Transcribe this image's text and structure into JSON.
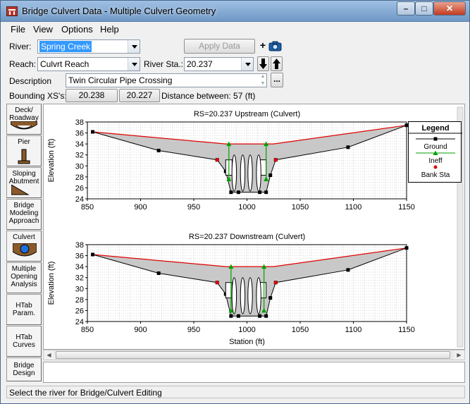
{
  "window": {
    "title": "Bridge Culvert Data - Multiple Culvert Geometry"
  },
  "menu": {
    "items": [
      "File",
      "View",
      "Options",
      "Help"
    ]
  },
  "river": {
    "label": "River:",
    "value": "Spring Creek"
  },
  "apply": {
    "label": "Apply Data"
  },
  "reach": {
    "label": "Reach:",
    "value": "Culvrt Reach"
  },
  "river_sta": {
    "label": "River Sta.:",
    "value": "20.237"
  },
  "description": {
    "label": "Description",
    "value": "Twin Circular Pipe Crossing",
    "ellipsis": "..."
  },
  "bounding": {
    "label": "Bounding XS's:",
    "upstream": "20.238",
    "downstream": "20.227",
    "distance_label": "Distance between: 57 (ft)"
  },
  "sidebar": {
    "items": [
      {
        "label": "Deck/ Roadway",
        "icon": "deck-roadway-icon"
      },
      {
        "label": "Pier",
        "icon": "pier-icon"
      },
      {
        "label": "Sloping Abutment",
        "icon": "sloping-abutment-icon"
      },
      {
        "label": "Bridge Modeling Approach"
      },
      {
        "label": "Culvert",
        "icon": "culvert-icon"
      },
      {
        "label": "Multiple Opening Analysis"
      },
      {
        "label": "HTab Param."
      },
      {
        "label": "HTab Curves"
      },
      {
        "label": "Bridge Design"
      }
    ]
  },
  "status": {
    "text": "Select the river for Bridge/Culvert Editing"
  },
  "colors": {
    "ground": "#000000",
    "ineff": "#00a000",
    "bank": "#e00000",
    "road": "#e00000",
    "fill": "#c8c8c8"
  },
  "chart_data": [
    {
      "type": "line",
      "title": "RS=20.237  Upstream  (Culvert)",
      "ylabel": "Elevation (ft)",
      "xlabel": "",
      "xlim": [
        850,
        1150
      ],
      "ylim": [
        24,
        38
      ],
      "xticks": [
        850,
        900,
        950,
        1000,
        1050,
        1100,
        1150
      ],
      "yticks": [
        24,
        26,
        28,
        30,
        32,
        34,
        36,
        38
      ],
      "grid": true,
      "legend": {
        "title": "Legend",
        "position": "top-right",
        "entries": [
          "Ground",
          "Ineff",
          "Bank Sta"
        ]
      },
      "ground": [
        [
          855,
          36.2
        ],
        [
          917,
          32.8
        ],
        [
          972,
          31.1
        ],
        [
          980,
          29.0
        ],
        [
          985,
          25.2
        ],
        [
          992,
          25.2
        ],
        [
          1012,
          25.2
        ],
        [
          1018,
          25.2
        ],
        [
          1022,
          28.3
        ],
        [
          1027,
          31.1
        ],
        [
          1095,
          33.4
        ],
        [
          1150,
          37.4
        ]
      ],
      "road_top": [
        [
          855,
          36.2
        ],
        [
          980,
          34.0
        ],
        [
          1025,
          34.0
        ],
        [
          1150,
          37.4
        ]
      ],
      "ineff": [
        [
          983,
          27.6,
          34.0
        ],
        [
          1018,
          27.6,
          34.0
        ]
      ],
      "bank": [
        [
          972,
          31.1
        ],
        [
          1027,
          31.1
        ]
      ],
      "culverts": [
        [
          988,
          30.5
        ],
        [
          996,
          30.5
        ],
        [
          1003,
          30.5
        ],
        [
          1011,
          30.5
        ]
      ],
      "culvert_boxes": [
        [
          980,
          28.3,
          986,
          31.1
        ],
        [
          1012,
          28.3,
          1018,
          31.1
        ]
      ]
    },
    {
      "type": "line",
      "title": "RS=20.237  Downstream  (Culvert)",
      "ylabel": "Elevation (ft)",
      "xlabel": "Station (ft)",
      "xlim": [
        850,
        1150
      ],
      "ylim": [
        24,
        38
      ],
      "xticks": [
        850,
        900,
        950,
        1000,
        1050,
        1100,
        1150
      ],
      "yticks": [
        24,
        26,
        28,
        30,
        32,
        34,
        36,
        38
      ],
      "grid": true,
      "ground": [
        [
          855,
          36.2
        ],
        [
          917,
          32.8
        ],
        [
          972,
          31.1
        ],
        [
          980,
          29.0
        ],
        [
          985,
          25.0
        ],
        [
          992,
          25.0
        ],
        [
          1012,
          25.0
        ],
        [
          1018,
          25.0
        ],
        [
          1022,
          28.3
        ],
        [
          1027,
          31.1
        ],
        [
          1095,
          33.4
        ],
        [
          1150,
          37.4
        ]
      ],
      "road_top": [
        [
          855,
          36.2
        ],
        [
          980,
          34.0
        ],
        [
          1025,
          34.0
        ],
        [
          1150,
          37.4
        ]
      ],
      "ineff": [
        [
          985,
          26.0,
          34.0
        ],
        [
          1016,
          26.0,
          34.0
        ]
      ],
      "bank": [
        [
          972,
          31.1
        ],
        [
          1027,
          31.1
        ]
      ],
      "culverts": [
        [
          988,
          30.5
        ],
        [
          996,
          30.5
        ],
        [
          1003,
          30.5
        ],
        [
          1011,
          30.5
        ]
      ],
      "culvert_boxes": [
        [
          980,
          28.3,
          986,
          31.1
        ],
        [
          1012,
          28.3,
          1018,
          31.1
        ]
      ]
    }
  ]
}
